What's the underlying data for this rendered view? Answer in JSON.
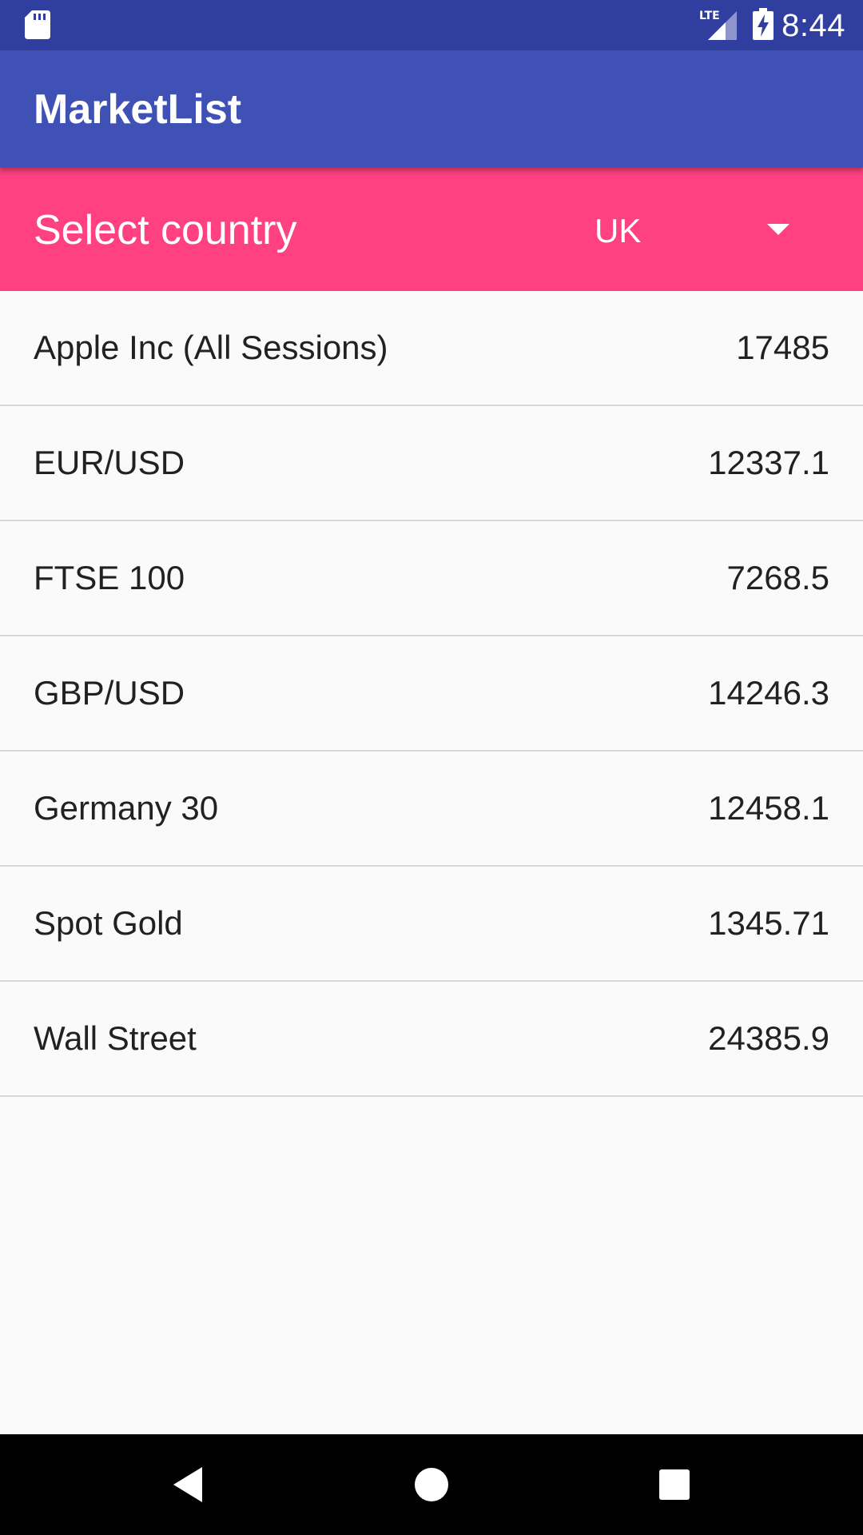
{
  "status_bar": {
    "time": "8:44",
    "network": "LTE",
    "icons": [
      "sd-card-icon",
      "lte-signal-icon",
      "battery-charging-icon"
    ]
  },
  "app_bar": {
    "title": "MarketList"
  },
  "country_selector": {
    "label": "Select country",
    "selected": "UK",
    "icon": "chevron-down-icon"
  },
  "markets": [
    {
      "name": "Apple Inc (All Sessions)",
      "price": "17485"
    },
    {
      "name": "EUR/USD",
      "price": "12337.1"
    },
    {
      "name": "FTSE 100",
      "price": "7268.5"
    },
    {
      "name": "GBP/USD",
      "price": "14246.3"
    },
    {
      "name": "Germany 30",
      "price": "12458.1"
    },
    {
      "name": "Spot Gold",
      "price": "1345.71"
    },
    {
      "name": "Wall Street",
      "price": "24385.9"
    }
  ],
  "nav_bar": {
    "icons": [
      "back-icon",
      "home-icon",
      "recents-icon"
    ]
  },
  "colors": {
    "status_bar": "#303f9f",
    "primary": "#3f51b5",
    "accent": "#ff4081",
    "background": "#fafafa",
    "text": "#212121",
    "divider": "#d9d9d9"
  }
}
